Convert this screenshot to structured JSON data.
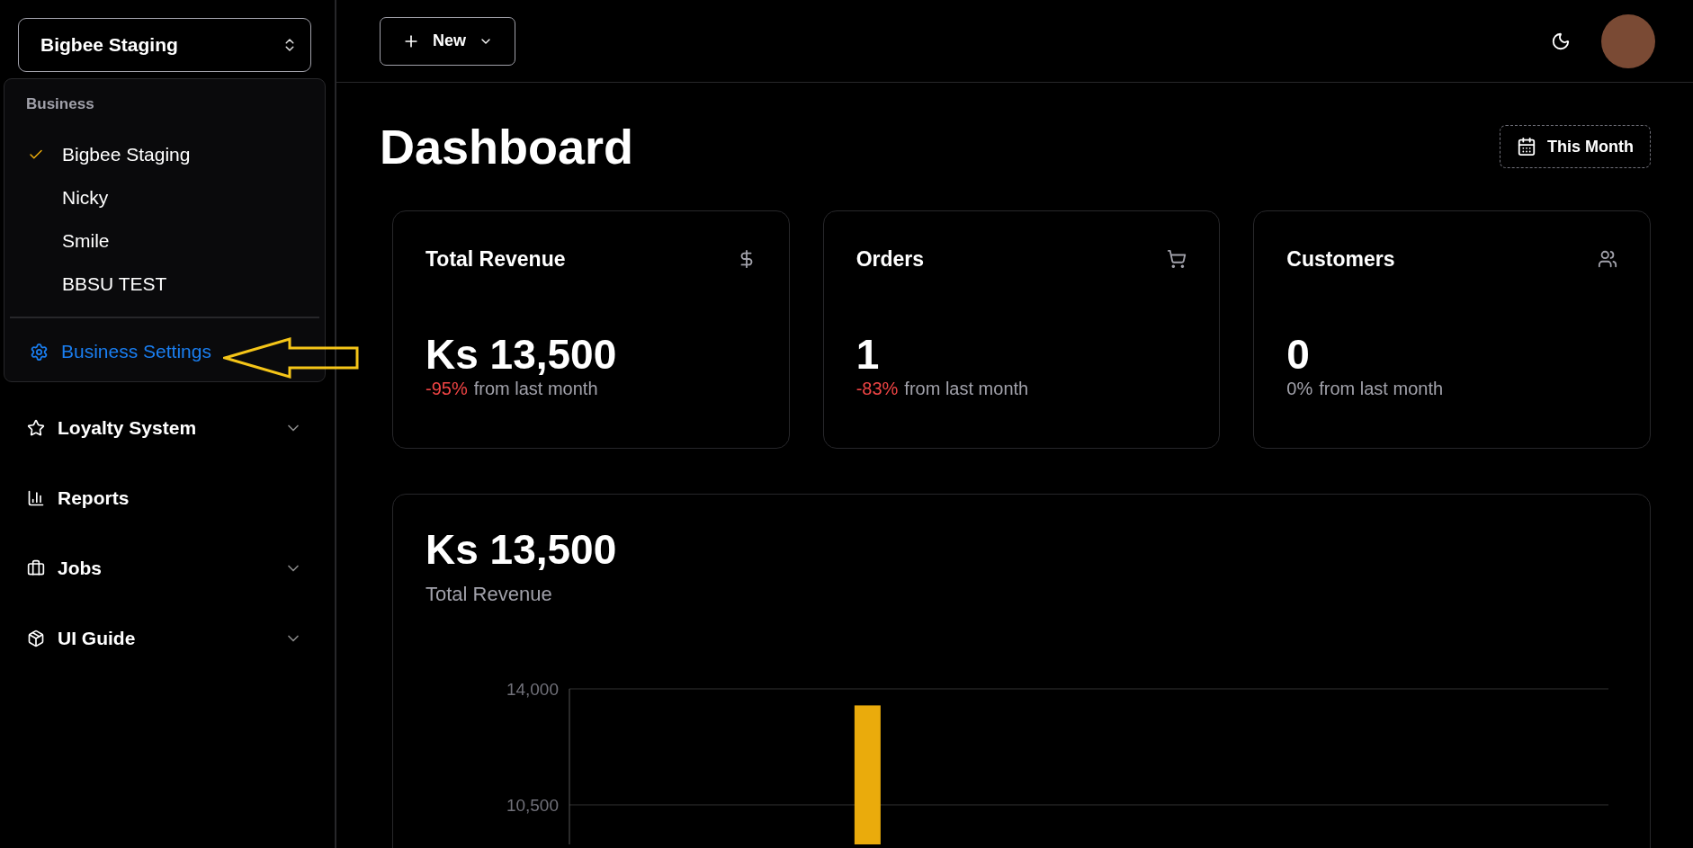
{
  "business_select": {
    "value": "Bigbee Staging"
  },
  "business_menu": {
    "heading": "Business",
    "items": [
      {
        "label": "Bigbee Staging",
        "selected": true
      },
      {
        "label": "Nicky",
        "selected": false
      },
      {
        "label": "Smile",
        "selected": false
      },
      {
        "label": "BBSU TEST",
        "selected": false
      }
    ],
    "settings": "Business Settings"
  },
  "sidebar": {
    "items": [
      {
        "label": "Loyalty System",
        "expandable": true
      },
      {
        "label": "Reports",
        "expandable": false
      },
      {
        "label": "Jobs",
        "expandable": true
      },
      {
        "label": "UI Guide",
        "expandable": true
      }
    ]
  },
  "topbar": {
    "new_button": "New"
  },
  "page": {
    "title": "Dashboard",
    "range_button": "This Month"
  },
  "cards": [
    {
      "title": "Total Revenue",
      "value": "Ks 13,500",
      "change": "-95%",
      "change_negative": true,
      "note": "from last month"
    },
    {
      "title": "Orders",
      "value": "1",
      "change": "-83%",
      "change_negative": true,
      "note": "from last month"
    },
    {
      "title": "Customers",
      "value": "0",
      "change": "0%",
      "change_negative": false,
      "note": "from last month"
    }
  ],
  "revenue_panel": {
    "value": "Ks 13,500",
    "label": "Total Revenue",
    "chart_data": {
      "type": "bar",
      "ylim": [
        9300,
        14000
      ],
      "yticks": [
        {
          "value": 10500,
          "label": "10,500"
        },
        {
          "value": 14000,
          "label": "14,000"
        }
      ],
      "series": [
        {
          "color": "#eaab0c",
          "values": [
            null,
            null,
            null,
            13500,
            null,
            null,
            null,
            null,
            null,
            null,
            null,
            null
          ]
        }
      ]
    }
  }
}
